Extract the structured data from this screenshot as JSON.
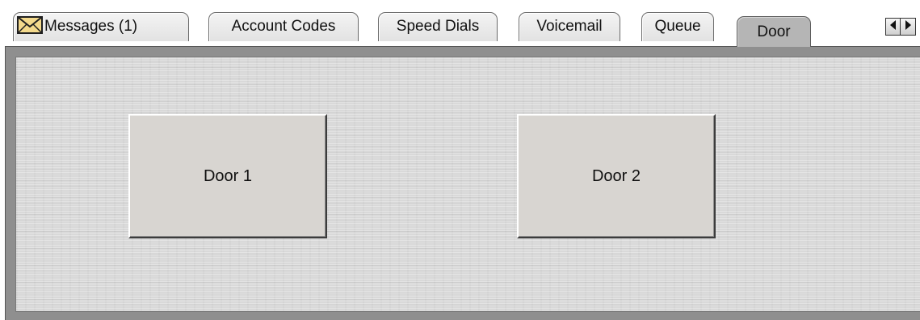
{
  "tabs": [
    {
      "label": "Messages (1)",
      "icon": "envelope-icon",
      "active": false
    },
    {
      "label": "Account Codes",
      "active": false
    },
    {
      "label": "Speed Dials",
      "active": false
    },
    {
      "label": "Voicemail",
      "active": false
    },
    {
      "label": "Queue",
      "active": false
    },
    {
      "label": "Door",
      "active": true
    }
  ],
  "tab_scroll": {
    "left_icon": "arrow-left-icon",
    "right_icon": "arrow-right-icon"
  },
  "door_panel": {
    "buttons": [
      {
        "label": "Door 1"
      },
      {
        "label": "Door 2"
      }
    ]
  },
  "colors": {
    "active_tab": "#b5b5b5",
    "inactive_tab": "#e8e8e8",
    "panel_background": "#d9d9d9",
    "button_face": "#d8d5d1",
    "envelope_fill": "#f3d98c"
  }
}
